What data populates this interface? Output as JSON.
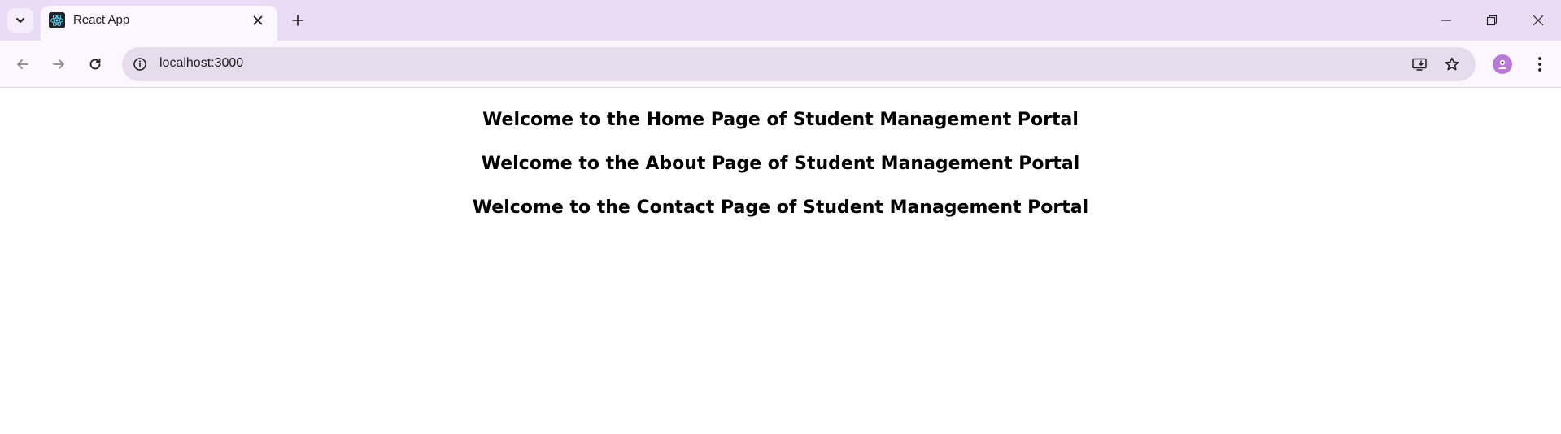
{
  "browser": {
    "tab": {
      "title": "React App",
      "favicon": "react-logo-icon"
    },
    "address_bar": {
      "url": "localhost:3000"
    },
    "colors": {
      "tabstrip": "#e9dcf4",
      "toolbar": "#fcf7ff",
      "omnibox": "#e6dcec",
      "profile": "#b97ad6"
    },
    "icons": {
      "tab_search": "chevron-down-icon",
      "tab_close": "close-icon",
      "new_tab": "plus-icon",
      "back": "arrow-left-icon",
      "forward": "arrow-right-icon",
      "reload": "reload-icon",
      "site_info": "info-icon",
      "install": "install-app-icon",
      "bookmark": "star-icon",
      "menu": "kebab-menu-icon",
      "minimize": "minimize-icon",
      "restore": "restore-icon",
      "close_window": "close-icon"
    }
  },
  "page": {
    "headings": [
      "Welcome to the Home Page of Student Management Portal",
      "Welcome to the About Page of Student Management Portal",
      "Welcome to the Contact Page of Student Management Portal"
    ]
  }
}
